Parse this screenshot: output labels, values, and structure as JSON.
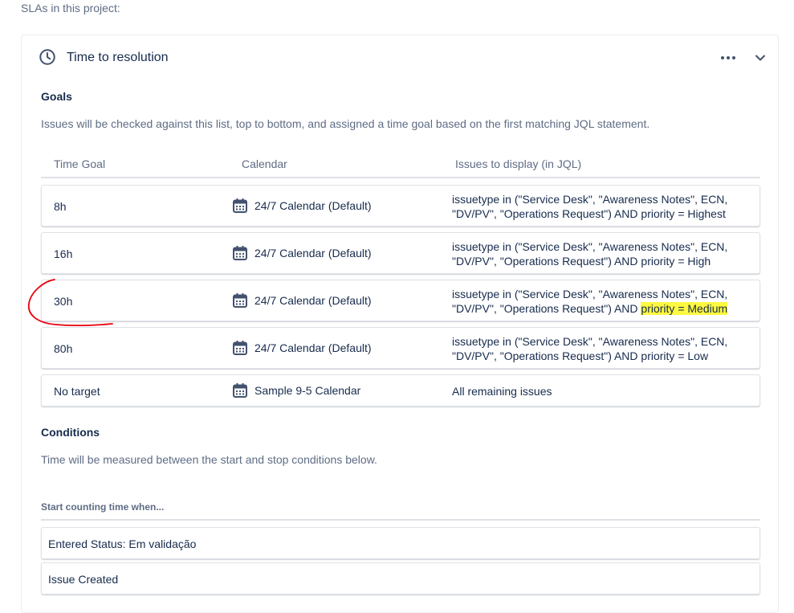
{
  "page": {
    "intro": "SLAs in this project:"
  },
  "sla": {
    "title": "Time to resolution",
    "icons": {
      "title": "clock-icon",
      "menu": "more-horizontal-icon",
      "toggle": "chevron-down-icon",
      "calendar": "calendar-icon"
    },
    "goals": {
      "heading": "Goals",
      "description": "Issues will be checked against this list, top to bottom, and assigned a time goal based on the first matching JQL statement.",
      "columns": {
        "time_goal": "Time Goal",
        "calendar": "Calendar",
        "jql": "Issues to display (in JQL)"
      },
      "rows": [
        {
          "time_goal": "8h",
          "calendar": "24/7 Calendar (Default)",
          "jql_line1": "issuetype in (\"Service Desk\", \"Awareness Notes\", ECN,",
          "jql_line2": "\"DV/PV\", \"Operations Request\") AND priority = Highest"
        },
        {
          "time_goal": "16h",
          "calendar": "24/7 Calendar (Default)",
          "jql_line1": "issuetype in (\"Service Desk\", \"Awareness Notes\", ECN,",
          "jql_line2": "\"DV/PV\", \"Operations Request\") AND priority = High"
        },
        {
          "time_goal": "30h",
          "calendar": "24/7 Calendar (Default)",
          "jql_line1": "issuetype in (\"Service Desk\", \"Awareness Notes\", ECN,",
          "jql_line2_prefix": "\"DV/PV\", \"Operations Request\") AND ",
          "jql_line2_highlight": "priority = Medium"
        },
        {
          "time_goal": "80h",
          "calendar": "24/7 Calendar (Default)",
          "jql_line1": "issuetype in (\"Service Desk\", \"Awareness Notes\", ECN,",
          "jql_line2": "\"DV/PV\", \"Operations Request\") AND priority = Low"
        },
        {
          "time_goal": "No target",
          "calendar": "Sample 9-5 Calendar",
          "jql_line1": "All remaining issues"
        }
      ]
    },
    "conditions": {
      "heading": "Conditions",
      "description": "Time will be measured between the start and stop conditions below.",
      "start_label": "Start counting time when...",
      "start_items": [
        "Entered Status: Em validação",
        "Issue Created"
      ]
    }
  },
  "colors": {
    "highlight": "#fff93f",
    "annotation": "#e8000b"
  }
}
